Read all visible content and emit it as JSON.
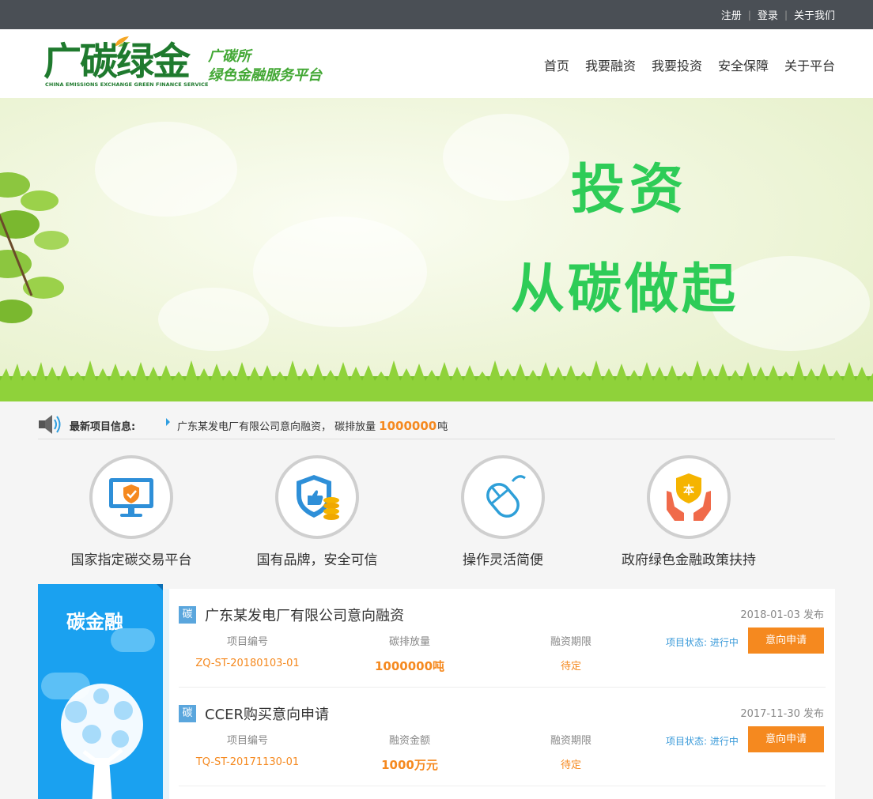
{
  "topbar": {
    "register": "注册",
    "login": "登录",
    "about_us": "关于我们"
  },
  "logo": {
    "mark": "广碳绿金",
    "en": "CHINA EMISSIONS EXCHANGE GREEN FINANCE SERVICE",
    "line1": "广碳所",
    "line2": "绿色金融服务平台"
  },
  "nav": [
    "首页",
    "我要融资",
    "我要投资",
    "安全保障",
    "关于平台"
  ],
  "banner": {
    "line1": "投资",
    "line2": "从碳做起"
  },
  "ticker": {
    "label": "最新项目信息:",
    "text": "广东某发电厂有限公司意向融资， 碳排放量",
    "number": "1000000",
    "unit": "吨"
  },
  "features": [
    {
      "icon": "monitor-shield-icon",
      "caption": "国家指定碳交易平台"
    },
    {
      "icon": "shield-coins-icon",
      "caption": "国有品牌，安全可信"
    },
    {
      "icon": "mouse-icon",
      "caption": "操作灵活简便"
    },
    {
      "icon": "hands-coin-icon",
      "caption": "政府绿色金融政策扶持"
    }
  ],
  "side_panel": {
    "title": "碳金融"
  },
  "projects": [
    {
      "tag": "碳",
      "name": "广东某发电厂有限公司意向融资",
      "date": "2018-01-03 发布",
      "col1_head": "项目编号",
      "col1_val": "ZQ-ST-20180103-01",
      "col2_head": "碳排放量",
      "col2_val": "1000000吨",
      "col3_head": "融资期限",
      "col3_val": "待定",
      "status": "项目状态:  进行中",
      "button": "意向申请"
    },
    {
      "tag": "碳",
      "name": "CCER购买意向申请",
      "date": "2017-11-30 发布",
      "col1_head": "项目编号",
      "col1_val": "TQ-ST-20171130-01",
      "col2_head": "融资金额",
      "col2_val": "1000万元",
      "col3_head": "融资期限",
      "col3_val": "待定",
      "status": "项目状态:  进行中",
      "button": "意向申请"
    }
  ],
  "colors": {
    "accent_green": "#2ecc57",
    "button_orange": "#f5891f",
    "side_blue": "#1aa1f0",
    "topbar": "#4a4f55"
  }
}
